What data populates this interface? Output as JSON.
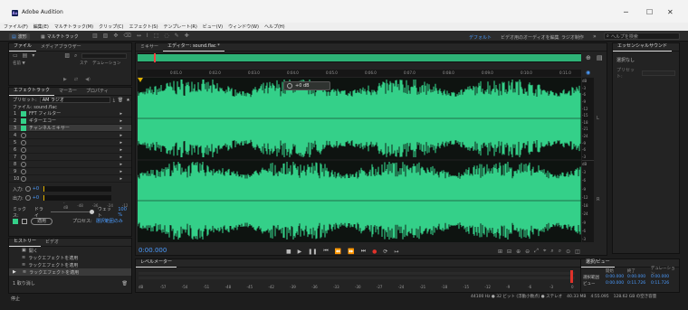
{
  "window": {
    "app_icon": "Au",
    "title": "Adobe Audition",
    "minimize": "─",
    "maximize": "☐",
    "close": "✕"
  },
  "menu": [
    "ファイル(F)",
    "編集(E)",
    "マルチトラック(M)",
    "クリップ(C)",
    "エフェクト(S)",
    "テンプレート(R)",
    "ビュー(V)",
    "ウィンドウ(W)",
    "ヘルプ(H)"
  ],
  "toolbar": {
    "waveform": "波形",
    "multitrack": "マルチトラック",
    "workspace_default": "デフォルト",
    "workspace_video": "ビデオ用のオーディオを編集",
    "workspace_radio": "ラジオ制作",
    "more": "»",
    "search_placeholder": "ヘルプを検索"
  },
  "files_panel": {
    "tabs": [
      "ファイル",
      "メディアブラウザー"
    ],
    "col_name": "名前 ▼",
    "col_status": "ステ",
    "col_duration": "デュレーション"
  },
  "fx_panel": {
    "tabs": [
      "エフェクトラック",
      "マーカー",
      "プロパティ"
    ],
    "preset_label": "プリセット:",
    "preset_value": "AM ラジオ",
    "file_label": "ファイル: sound.flac",
    "rows": [
      {
        "n": "1",
        "name": "FFT フィルター"
      },
      {
        "n": "2",
        "name": "ギターエコー"
      },
      {
        "n": "3",
        "name": "チャンネルミキサー"
      },
      {
        "n": "4",
        "name": ""
      },
      {
        "n": "5",
        "name": ""
      },
      {
        "n": "6",
        "name": ""
      },
      {
        "n": "7",
        "name": ""
      },
      {
        "n": "8",
        "name": ""
      },
      {
        "n": "9",
        "name": ""
      },
      {
        "n": "10",
        "name": ""
      }
    ],
    "input_label": "入力:",
    "input_val": "+0",
    "output_label": "出力:",
    "output_val": "+0",
    "meter_scale": [
      "-dB",
      "-48",
      "-36",
      "-24",
      "-12",
      "0"
    ],
    "mix_label": "ミックス:",
    "dry": "ドライ",
    "wet": "ウェット",
    "wet_val": "100 %",
    "apply": "適用",
    "process_label": "プロセス:",
    "process_value": "選択範囲のみ"
  },
  "history_panel": {
    "tabs": [
      "ヒストリー",
      "ビデオ"
    ],
    "items": [
      "開く",
      "ラックエフェクトを適用",
      "ラックエフェクトを適用",
      "ラックエフェクトを適用"
    ],
    "undo": "1 取り消し"
  },
  "status_left": "停止",
  "editor": {
    "tabs": [
      "ミキサー",
      "エディター: sound.flac *"
    ],
    "time_ticks": [
      "0:01.0",
      "0:02.0",
      "0:03.0",
      "0:04.0",
      "0:05.0",
      "0:06.0",
      "0:07.0",
      "0:08.0",
      "0:09.0",
      "0:10.0",
      "0:11.0"
    ],
    "hud_db": "+0 dB",
    "current_time": "0:00.000",
    "db_scale_top": [
      "dB",
      "-3",
      "-6",
      "-9",
      "-12",
      "-15",
      "-18",
      "-21",
      "-24",
      "-9",
      "-6",
      "-3"
    ],
    "db_scale_bot": [
      "dB",
      "-3",
      "-6",
      "-9",
      "-12",
      "-18",
      "-24",
      "-9",
      "-6",
      "-3"
    ],
    "ch_top": "L",
    "ch_bot": "R"
  },
  "levels_panel": {
    "title": "レベルメーター",
    "scale": [
      "dB",
      "-57",
      "-54",
      "-51",
      "-48",
      "-45",
      "-42",
      "-39",
      "-36",
      "-33",
      "-30",
      "-27",
      "-24",
      "-21",
      "-18",
      "-15",
      "-12",
      "-9",
      "-6",
      "-3",
      "0"
    ]
  },
  "status_bar": {
    "format": "44100 Hz ● 32 ビット (浮動小数点) ● ステレオ",
    "size": "40.33 MB",
    "duration": "4:55.095",
    "disk": "128.62 GB の空き容量"
  },
  "essential_panel": {
    "title": "エッセンシャルサウンド",
    "clip_label": "選択なし",
    "preset_label": "プリセット:"
  },
  "selection_panel": {
    "title": "選択/ビュー",
    "col_start": "開始",
    "col_end": "終了",
    "col_duration": "デュレーション",
    "rows": [
      {
        "label": "選択範囲",
        "start": "0:00.000",
        "end": "0:00.000",
        "dur": "0:00.000"
      },
      {
        "label": "ビュー",
        "start": "0:00.000",
        "end": "0:11.726",
        "dur": "0:11.726"
      }
    ]
  },
  "colors": {
    "wave": "#34d089",
    "accent": "#4b9cff",
    "playhead": "#e0b000",
    "record": "#e0322a"
  }
}
